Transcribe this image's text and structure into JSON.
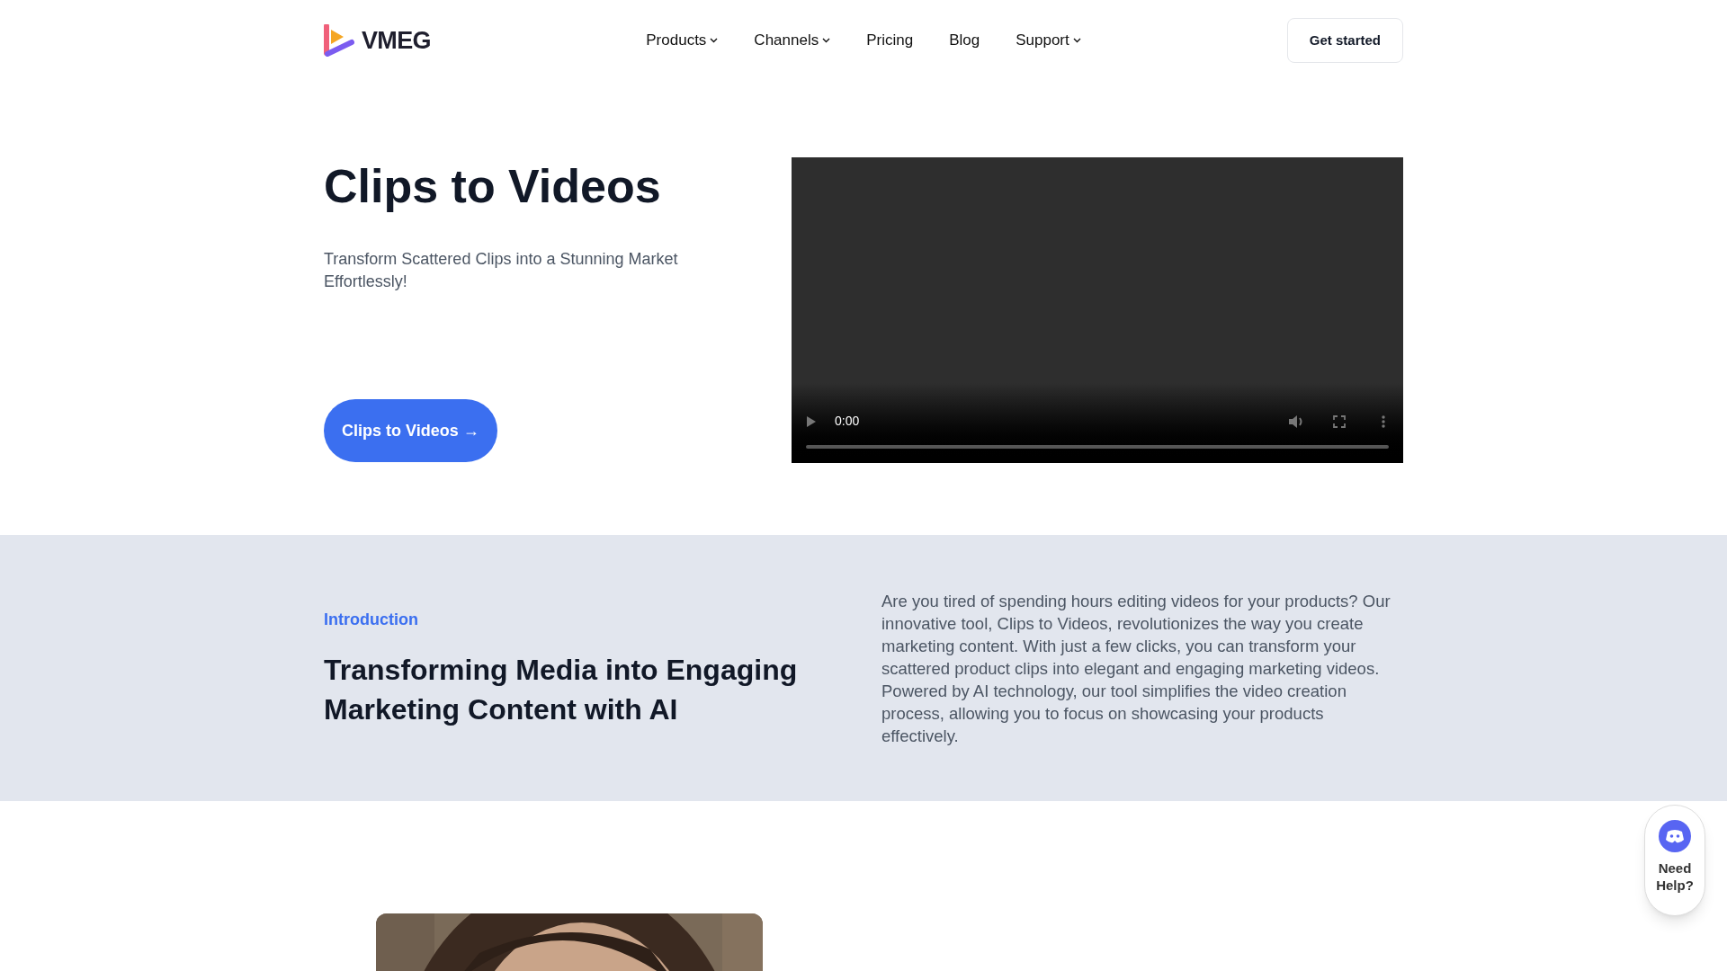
{
  "header": {
    "logo_text": "VMEG",
    "nav": [
      {
        "label": "Products",
        "dropdown": true
      },
      {
        "label": "Channels",
        "dropdown": true
      },
      {
        "label": "Pricing",
        "dropdown": false
      },
      {
        "label": "Blog",
        "dropdown": false
      },
      {
        "label": "Support",
        "dropdown": true
      }
    ],
    "cta": "Get started"
  },
  "hero": {
    "title": "Clips to Videos",
    "subtitle": "Transform Scattered Clips into a Stunning Market Effortlessly!",
    "button": "Clips to Videos →",
    "video": {
      "time": "0:00",
      "level": 0
    }
  },
  "intro": {
    "eyebrow": "Introduction",
    "heading": "Transforming Media into Engaging Marketing Content with AI",
    "body": "Are you tired of spending hours editing videos for your products? Our innovative tool, Clips to Videos, revolutionizes the way you create marketing content. With just a few clicks, you can transform your scattered product clips into elegant and engaging marketing videos. Powered by AI technology, our tool simplifies the video creation process, allowing you to focus on showcasing your products effectively."
  },
  "help_widget": {
    "label": "Need Help?"
  }
}
